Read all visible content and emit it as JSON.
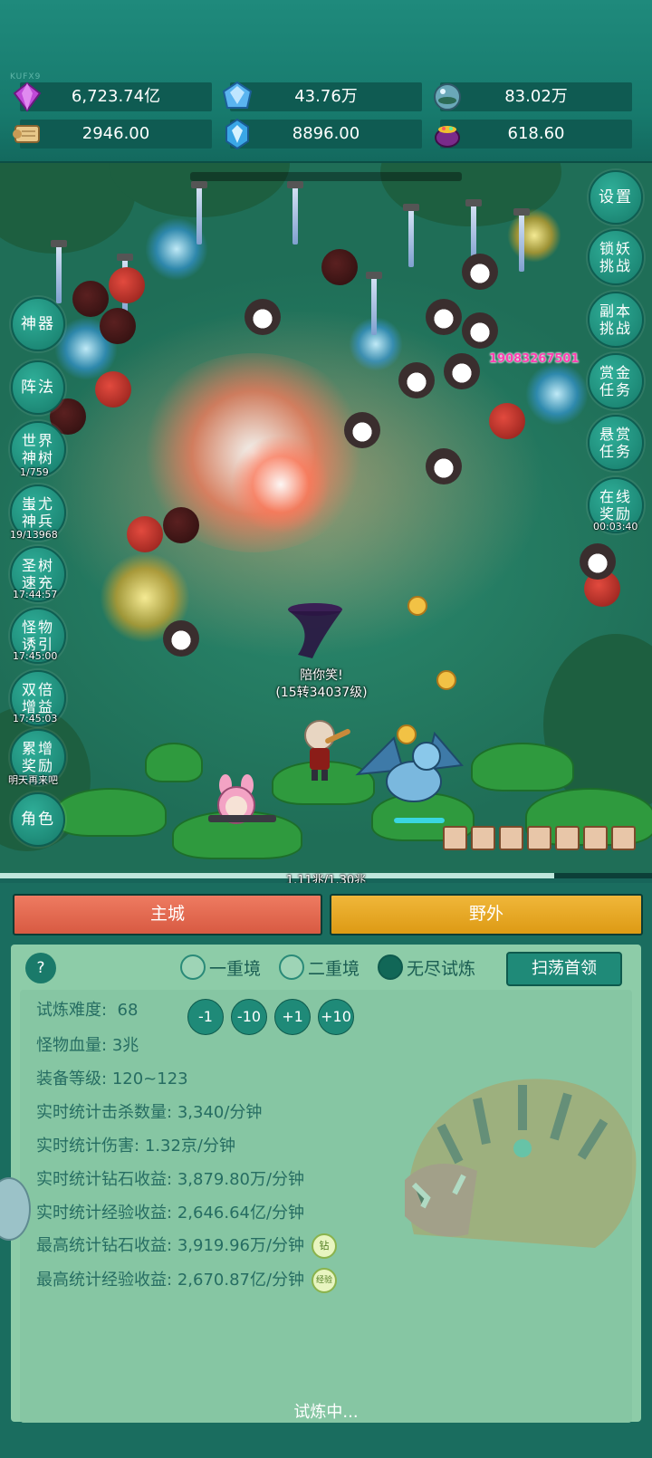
{
  "watermark": "KUFX9",
  "resources": [
    {
      "icon": "purple-gem-icon",
      "value": "6,723.74亿"
    },
    {
      "icon": "blue-crystal-icon",
      "value": "43.76万"
    },
    {
      "icon": "orb-icon",
      "value": "83.02万"
    },
    {
      "icon": "scroll-icon",
      "value": "2946.00"
    },
    {
      "icon": "ice-crystal-icon",
      "value": "8896.00"
    },
    {
      "icon": "treasure-pot-icon",
      "value": "618.60"
    }
  ],
  "left_menu": [
    {
      "label": "神器",
      "sub": ""
    },
    {
      "label": "阵法",
      "sub": ""
    },
    {
      "label": "世界神树",
      "sub": "1/759"
    },
    {
      "label": "蚩尤神兵",
      "sub": "19/13968"
    },
    {
      "label": "圣树速充",
      "sub": "17:44:57"
    },
    {
      "label": "怪物诱引",
      "sub": "17:45:00"
    },
    {
      "label": "双倍增益",
      "sub": "17:45:03"
    },
    {
      "label": "累增奖励",
      "sub": "明天再来吧"
    },
    {
      "label": "角色",
      "sub": ""
    }
  ],
  "right_menu": [
    {
      "label": "设置",
      "sub": ""
    },
    {
      "label": "锁妖挑战",
      "sub": ""
    },
    {
      "label": "副本挑战",
      "sub": ""
    },
    {
      "label": "赏金任务",
      "sub": ""
    },
    {
      "label": "悬赏任务",
      "sub": ""
    },
    {
      "label": "在线奖励",
      "sub": "00:03:40"
    }
  ],
  "damage_number": "19083267501",
  "player": {
    "name": "陪你笑!",
    "level": "(15转34037级)",
    "hp_fraction": 1.0
  },
  "exp": {
    "label": "1.11兆/1.30兆",
    "fraction": 0.85
  },
  "tabs": {
    "city": "主城",
    "wild": "野外"
  },
  "trial": {
    "help": "?",
    "modes": [
      {
        "label": "一重境",
        "selected": false
      },
      {
        "label": "二重境",
        "selected": false
      },
      {
        "label": "无尽试炼",
        "selected": true
      }
    ],
    "sweep_button": "扫荡首领",
    "difficulty_label": "试炼难度:",
    "difficulty_value": "68",
    "difficulty_buttons": [
      "-1",
      "-10",
      "+1",
      "+10"
    ],
    "stats": [
      {
        "label": "怪物血量:",
        "value": "3兆"
      },
      {
        "label": "装备等级:",
        "value": "120~123"
      },
      {
        "label": "实时统计击杀数量:",
        "value": "3,340/分钟"
      },
      {
        "label": "实时统计伤害:",
        "value": "1.32京/分钟"
      },
      {
        "label": "实时统计钻石收益:",
        "value": "3,879.80万/分钟"
      },
      {
        "label": "实时统计经验收益:",
        "value": "2,646.64亿/分钟"
      },
      {
        "label": "最高统计钻石收益:",
        "value": "3,919.96万/分钟",
        "badge": "钻"
      },
      {
        "label": "最高统计经验收益:",
        "value": "2,670.87亿/分钟",
        "badge": "经验"
      }
    ],
    "status": "试炼中..."
  },
  "colors": {
    "accent": "#1f8a78",
    "city": "#e06a4f",
    "wild": "#e8a825"
  }
}
